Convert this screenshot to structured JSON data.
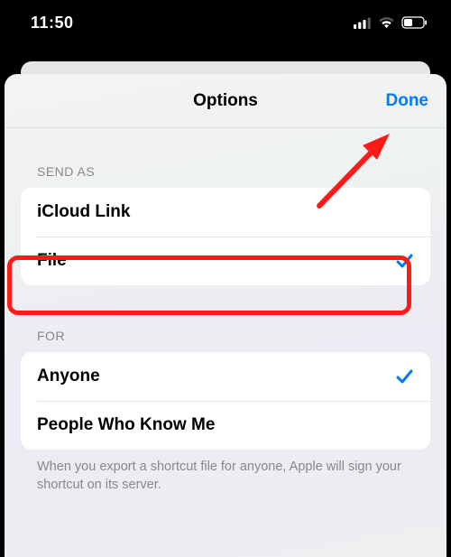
{
  "status": {
    "time": "11:50"
  },
  "nav": {
    "title": "Options",
    "done": "Done"
  },
  "sections": {
    "sendAs": {
      "header": "SEND AS",
      "items": [
        {
          "label": "iCloud Link",
          "selected": false
        },
        {
          "label": "File",
          "selected": true
        }
      ]
    },
    "for": {
      "header": "FOR",
      "items": [
        {
          "label": "Anyone",
          "selected": true
        },
        {
          "label": "People Who Know Me",
          "selected": false
        }
      ]
    }
  },
  "footer": "When you export a shortcut file for anyone, Apple will sign your shortcut on its server.",
  "colors": {
    "accent": "#007aff",
    "highlight": "#ff1a1a"
  }
}
